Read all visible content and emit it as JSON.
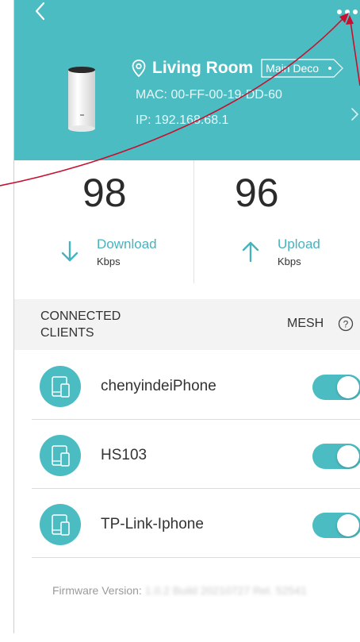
{
  "header": {
    "location_name": "Living Room",
    "deco_tag": "Main Deco",
    "mac": "MAC: 00-FF-00-19-DD-60",
    "ip": "IP: 192.168.68.1"
  },
  "speed": {
    "download_value": "98",
    "download_label": "Download",
    "download_unit": "Kbps",
    "upload_value": "96",
    "upload_label": "Upload",
    "upload_unit": "Kbps"
  },
  "clients_section": {
    "title": "CONNECTED CLIENTS",
    "mesh_label": "MESH"
  },
  "clients": [
    {
      "name": "chenyindeiPhone",
      "enabled": true
    },
    {
      "name": "HS103",
      "enabled": true
    },
    {
      "name": "TP-Link-Iphone",
      "enabled": true
    }
  ],
  "footer": {
    "firmware_label": "Firmware Version:",
    "firmware_value": "1.0.2 Build 20210727 Rel. 52541"
  },
  "colors": {
    "accent": "#4cbcc3",
    "annotation": "#c8102e"
  },
  "icons": {
    "back": "chevron-left-icon",
    "more": "more-dots-icon",
    "location": "location-pin-icon",
    "download": "arrow-down-icon",
    "upload": "arrow-up-icon",
    "help": "question-circle-icon",
    "client": "devices-icon"
  }
}
